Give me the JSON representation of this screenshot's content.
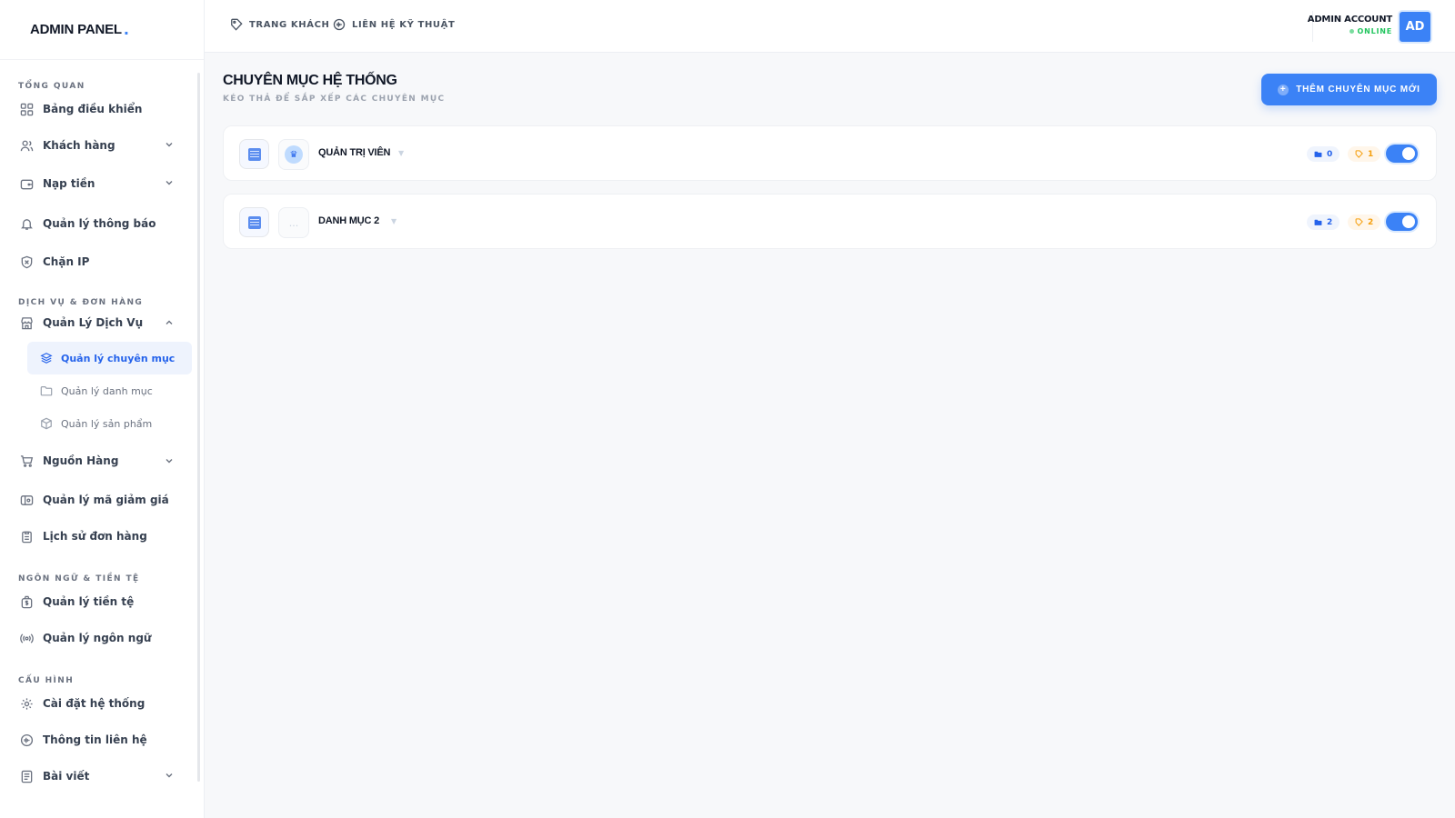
{
  "brand": {
    "name": "ADMIN PANEL",
    "dot": "."
  },
  "sidebar": {
    "sections": [
      {
        "title": "TỔNG QUAN"
      },
      {
        "title": "DỊCH VỤ & ĐƠN HÀNG"
      },
      {
        "title": "NGÔN NGỮ & TIỀN TỆ"
      },
      {
        "title": "CẤU HÌNH"
      }
    ],
    "items": [
      {
        "label": "Bảng điều khiển",
        "icon": "grid-icon"
      },
      {
        "label": "Khách hàng",
        "icon": "users-icon",
        "expandable": true
      },
      {
        "label": "Nạp tiền",
        "icon": "wallet-icon",
        "expandable": true
      },
      {
        "label": "Quản lý thông báo",
        "icon": "bell-icon"
      },
      {
        "label": "Chặn IP",
        "icon": "shield-x-icon"
      },
      {
        "label": "Quản Lý Dịch Vụ",
        "icon": "store-icon",
        "expanded": true
      },
      {
        "label": "Nguồn Hàng",
        "icon": "cart-icon",
        "expandable": true
      },
      {
        "label": "Quản lý mã giảm giá",
        "icon": "coupon-icon"
      },
      {
        "label": "Lịch sử đơn hàng",
        "icon": "clipboard-icon"
      },
      {
        "label": "Quản lý tiền tệ",
        "icon": "money-bag-icon"
      },
      {
        "label": "Quản lý ngôn ngữ",
        "icon": "broadcast-icon"
      },
      {
        "label": "Cài đặt hệ thống",
        "icon": "gear-icon"
      },
      {
        "label": "Thông tin liên hệ",
        "icon": "support-icon"
      },
      {
        "label": "Bài viết",
        "icon": "document-icon",
        "expandable": true
      }
    ],
    "subitems": [
      {
        "label": "Quản lý chuyên mục",
        "icon": "layers-icon",
        "active": true
      },
      {
        "label": "Quản lý danh mục",
        "icon": "folder-icon"
      },
      {
        "label": "Quản lý sản phẩm",
        "icon": "box-icon"
      }
    ]
  },
  "topbar": {
    "links": [
      {
        "label": "TRANG KHÁCH",
        "icon": "tag-icon"
      },
      {
        "label": "LIÊN HỆ KỸ THUẬT",
        "icon": "support-icon"
      }
    ],
    "account": {
      "name": "ADMIN ACCOUNT",
      "status": "ONLINE",
      "initials": "AD"
    }
  },
  "main": {
    "title": "CHUYÊN MỤC HỆ THỐNG",
    "subtitle": "KÉO THẢ ĐỂ SẮP XẾP CÁC CHUYÊN MỤC",
    "add_button": "THÊM CHUYÊN MỤC MỚI",
    "categories": [
      {
        "name": "QUẢN TRỊ VIÊN",
        "folders": "0",
        "products": "1",
        "enabled": true,
        "thumb": "crown-icon"
      },
      {
        "name": "DANH MỤC 2",
        "folders": "2",
        "products": "2",
        "enabled": true,
        "thumb": "..."
      }
    ]
  },
  "colors": {
    "accent": "#3b82f6",
    "online": "#22c55e",
    "badge_orange": "#f59e0b"
  }
}
